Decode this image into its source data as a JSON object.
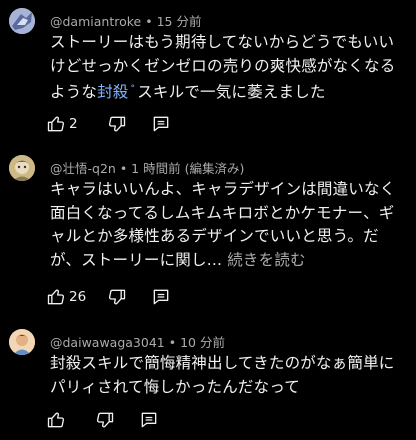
{
  "comments": [
    {
      "author": "@damiantroke",
      "time": "15 分前",
      "text_before": "ストーリーはもう期待してないからどうでもいいけどせっかくゼンゼロの売りの爽快感がなくなるような",
      "link_text": "封殺",
      "text_after": "スキルで一気に萎えました",
      "likes": "2"
    },
    {
      "author": "@壮悟-q2n",
      "time": "1 時間前",
      "edited": "(編集済み)",
      "text": "キャラはいいんよ、キャラデザインは間違いなく面白くなってるしムキムキロボとかケモナー、ギャルとか多様性あるデザインでいいと思う。だが、ストーリーに関し...",
      "more_label": "続きを読む",
      "likes": "26"
    },
    {
      "author": "@daiwawaga3041",
      "time": "10 分前",
      "text": "封殺スキルで簡悔精神出してきたのがなぁ簡単にパリィされて悔しかったんだなって"
    }
  ],
  "separator": "•",
  "icons": [
    "like-icon",
    "dislike-icon",
    "reply-icon"
  ],
  "colors": {
    "background": "#000000",
    "link": "#7fb2ff",
    "secondary": "#aaaaaa"
  }
}
